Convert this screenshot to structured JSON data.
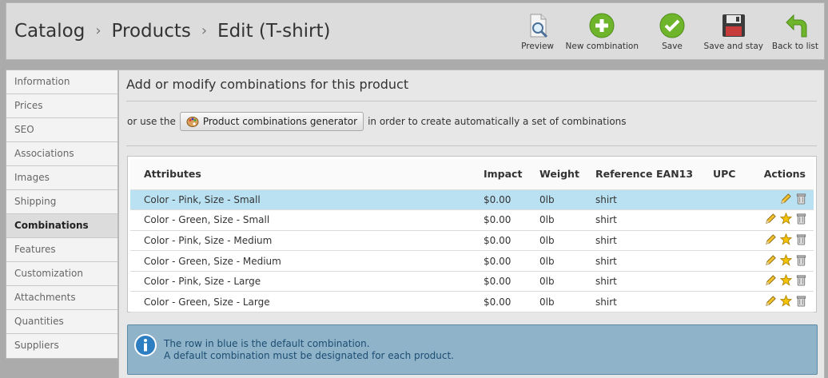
{
  "header": {
    "breadcrumb": [
      "Catalog",
      "Products",
      "Edit (T-shirt)"
    ],
    "separator": "›",
    "toolbar": {
      "preview": "Preview",
      "new_combination": "New combination",
      "save": "Save",
      "save_and_stay": "Save and stay",
      "back_to_list": "Back to list"
    }
  },
  "sidebar": {
    "items": [
      {
        "label": "Information"
      },
      {
        "label": "Prices"
      },
      {
        "label": "SEO"
      },
      {
        "label": "Associations"
      },
      {
        "label": "Images"
      },
      {
        "label": "Shipping"
      },
      {
        "label": "Combinations"
      },
      {
        "label": "Features"
      },
      {
        "label": "Customization"
      },
      {
        "label": "Attachments"
      },
      {
        "label": "Quantities"
      },
      {
        "label": "Suppliers"
      }
    ],
    "active": "Combinations"
  },
  "main": {
    "title": "Add or modify combinations for this product",
    "generator": {
      "prefix": "or use the",
      "button_label": "Product combinations generator",
      "suffix": "in order to create automatically a set of combinations"
    },
    "table": {
      "columns": [
        "Attributes",
        "Impact",
        "Weight",
        "Reference",
        "EAN13",
        "UPC",
        "Actions"
      ],
      "rows": [
        {
          "attributes": "Color - Pink, Size - Small",
          "impact": "$0.00",
          "weight": "0lb",
          "reference": "shirt",
          "ean13": "",
          "upc": "",
          "is_default": true
        },
        {
          "attributes": "Color - Green, Size - Small",
          "impact": "$0.00",
          "weight": "0lb",
          "reference": "shirt",
          "ean13": "",
          "upc": "",
          "is_default": false
        },
        {
          "attributes": "Color - Pink, Size - Medium",
          "impact": "$0.00",
          "weight": "0lb",
          "reference": "shirt",
          "ean13": "",
          "upc": "",
          "is_default": false
        },
        {
          "attributes": "Color - Green, Size - Medium",
          "impact": "$0.00",
          "weight": "0lb",
          "reference": "shirt",
          "ean13": "",
          "upc": "",
          "is_default": false
        },
        {
          "attributes": "Color - Pink, Size - Large",
          "impact": "$0.00",
          "weight": "0lb",
          "reference": "shirt",
          "ean13": "",
          "upc": "",
          "is_default": false
        },
        {
          "attributes": "Color - Green, Size - Large",
          "impact": "$0.00",
          "weight": "0lb",
          "reference": "shirt",
          "ean13": "",
          "upc": "",
          "is_default": false
        }
      ]
    },
    "info": {
      "line1": "The row in blue is the default combination.",
      "line2": "A default combination must be designated for each product."
    }
  },
  "colors": {
    "default_row": "#b9e1f2",
    "info_bg": "#8fb3c8",
    "info_text": "#1c4d73",
    "green_button": "#6fb52c"
  }
}
